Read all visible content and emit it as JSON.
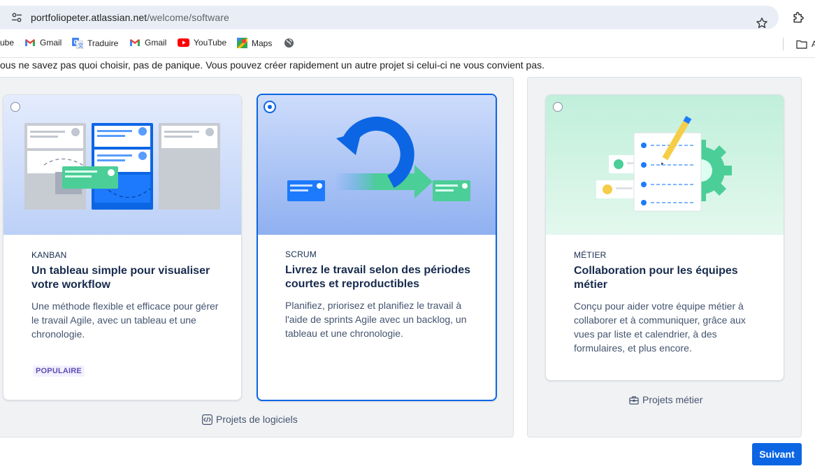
{
  "browser": {
    "url_host": "portfoliopeter.atlassian.net",
    "url_path": "/welcome/software",
    "bookmarks": [
      {
        "label": "ube",
        "icon": "youtube-icon-cropped"
      },
      {
        "label": "Gmail",
        "icon": "gmail-icon"
      },
      {
        "label": "Traduire",
        "icon": "translate-icon"
      },
      {
        "label": "Gmail",
        "icon": "gmail-icon"
      },
      {
        "label": "YouTube",
        "icon": "youtube-icon"
      },
      {
        "label": "Maps",
        "icon": "maps-icon"
      },
      {
        "label": "",
        "icon": "globe-icon"
      }
    ],
    "folder_label": "A"
  },
  "intro": "ous ne savez pas quoi choisir, pas de panique. Vous pouvez créer rapidement un autre projet si celui-ci ne vous convient pas.",
  "cards": {
    "kanban": {
      "category": "KANBAN",
      "title": "Un tableau simple pour visualiser votre workflow",
      "description": "Une méthode flexible et efficace pour gérer le travail Agile, avec un tableau et une chronologie.",
      "badge": "POPULAIRE",
      "selected": false
    },
    "scrum": {
      "category": "SCRUM",
      "title": "Livrez le travail selon des périodes courtes et reproductibles",
      "description": "Planifiez, priorisez et planifiez le travail à l'aide de sprints Agile avec un backlog, un tableau et une chronologie.",
      "selected": true
    },
    "metier": {
      "category": "MÉTIER",
      "title": "Collaboration pour les équipes métier",
      "description": "Conçu pour aider votre équipe métier à collaborer et à communiquer, grâce aux vues par liste et calendrier, à des formulaires, et plus encore.",
      "selected": false
    }
  },
  "groups": {
    "software_label": "Projets de logiciels",
    "business_label": "Projets métier"
  },
  "next_button": "Suivant",
  "colors": {
    "primary": "#0c66e4",
    "badge_text": "#5e4db2",
    "badge_bg": "#f3f0ff",
    "panel_bg": "#f1f2f4"
  }
}
